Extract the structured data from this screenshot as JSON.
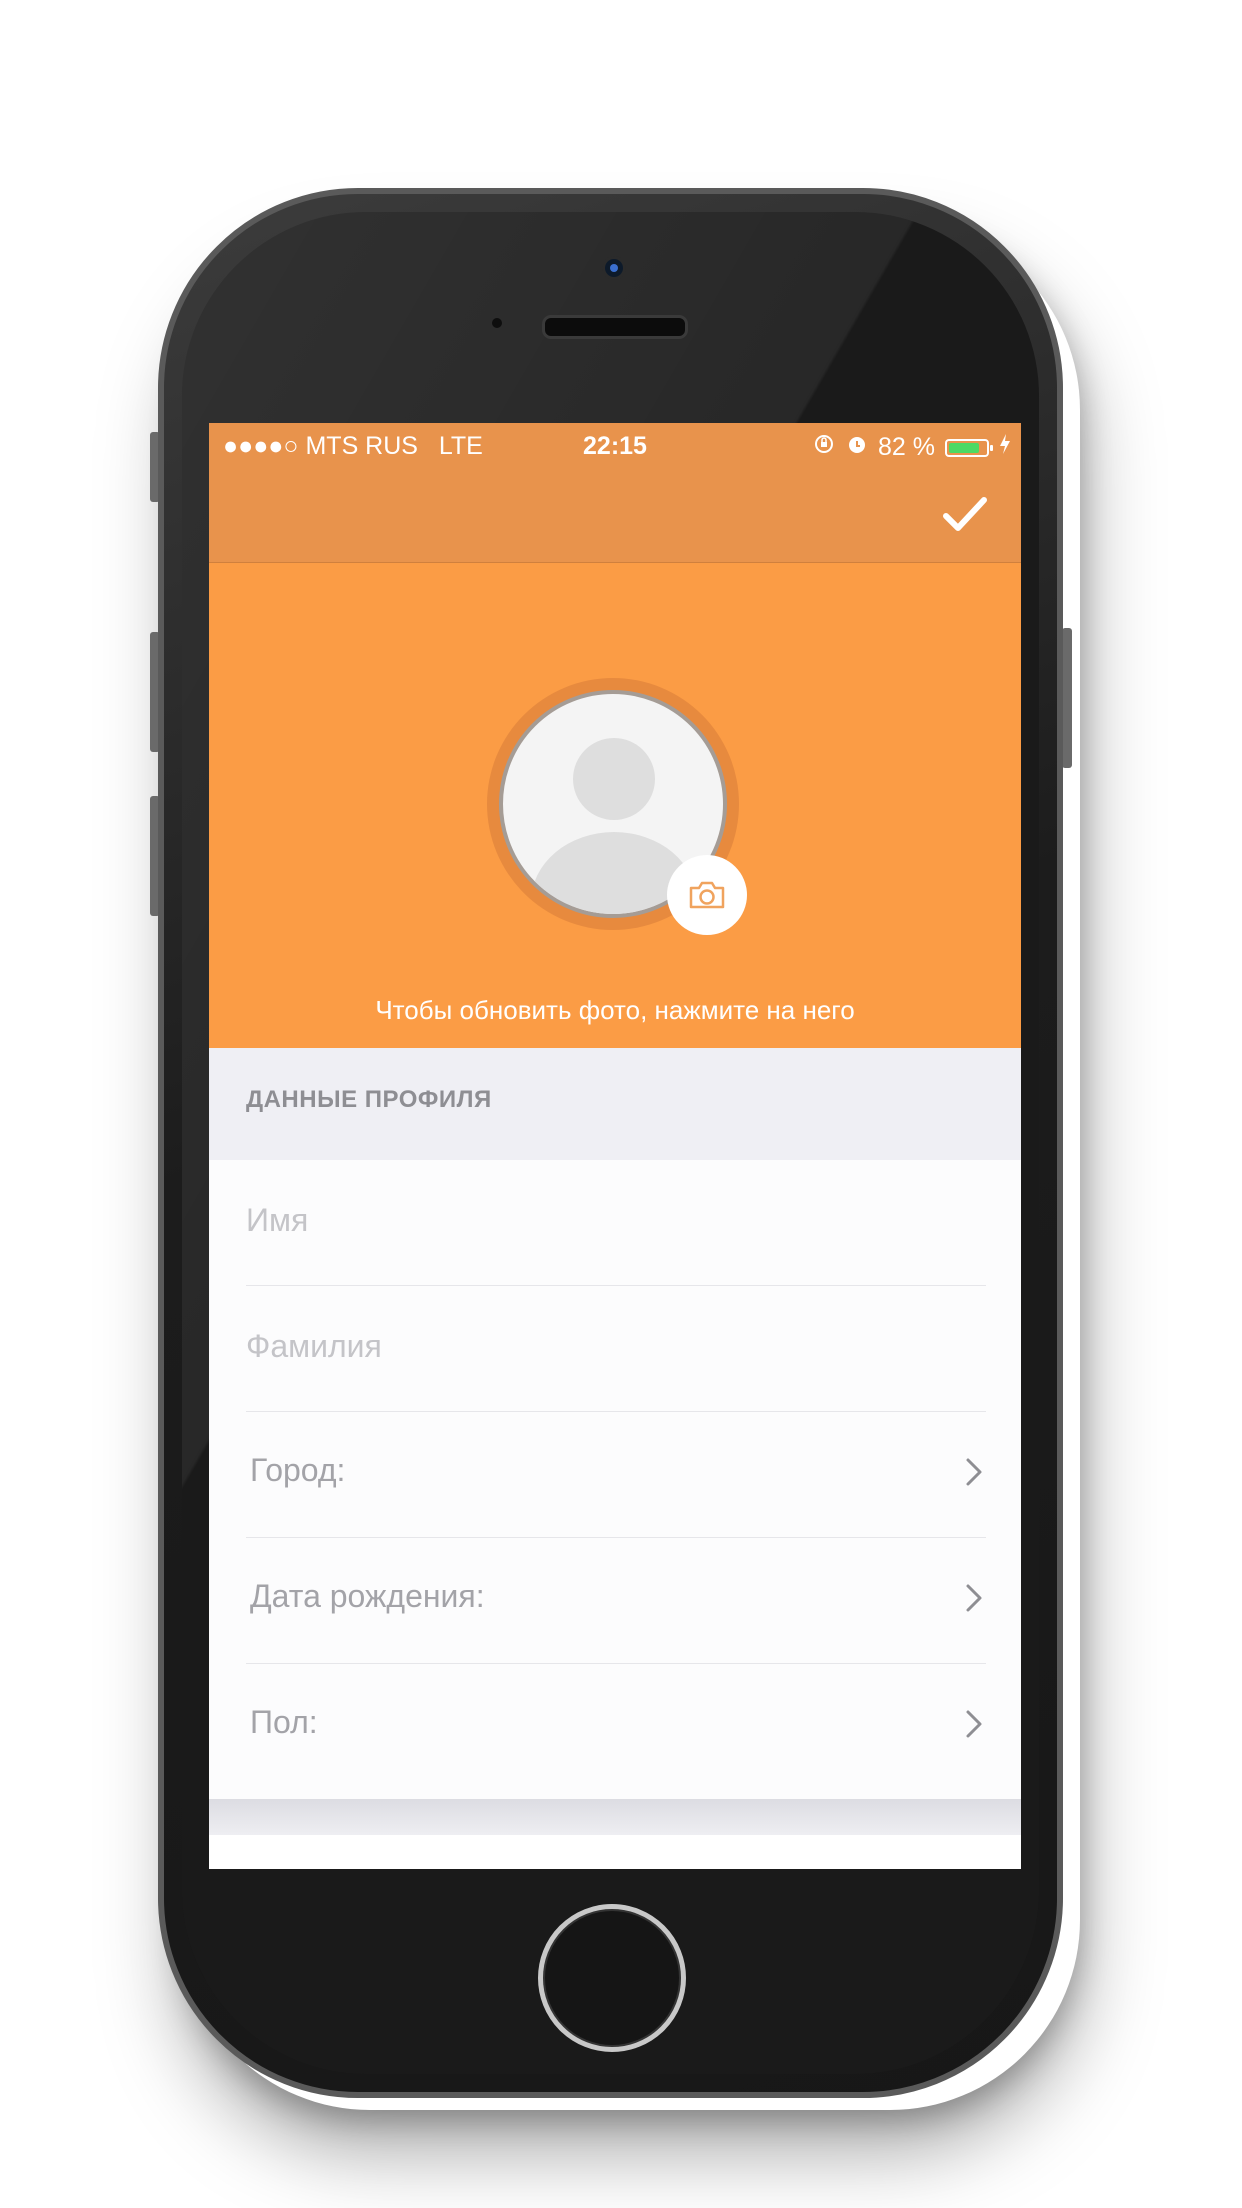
{
  "status_bar": {
    "signal": "●●●●○",
    "carrier": "MTS RUS",
    "network": "LTE",
    "time": "22:15",
    "battery_percent": "82 %",
    "battery_level": 0.82,
    "icons": [
      "rotation-lock-icon",
      "alarm-icon",
      "battery-icon",
      "charging-icon"
    ]
  },
  "navbar": {
    "confirm_icon": "checkmark-icon"
  },
  "profile_header": {
    "avatar_icon": "avatar-placeholder-icon",
    "camera_icon": "camera-icon",
    "hint": "Чтобы обновить фото, нажмите на него"
  },
  "section": {
    "title": "ДАННЫЕ ПРОФИЛЯ"
  },
  "form": {
    "first_name": {
      "placeholder": "Имя",
      "value": ""
    },
    "last_name": {
      "placeholder": "Фамилия",
      "value": ""
    },
    "city": {
      "label": "Город:"
    },
    "birth_date": {
      "label": "Дата рождения:"
    },
    "gender": {
      "label": "Пол:"
    }
  },
  "colors": {
    "accent": "#fb9c45",
    "navbar": "#e8934c",
    "section_bg": "#efeff4",
    "battery_green": "#4cd964"
  }
}
